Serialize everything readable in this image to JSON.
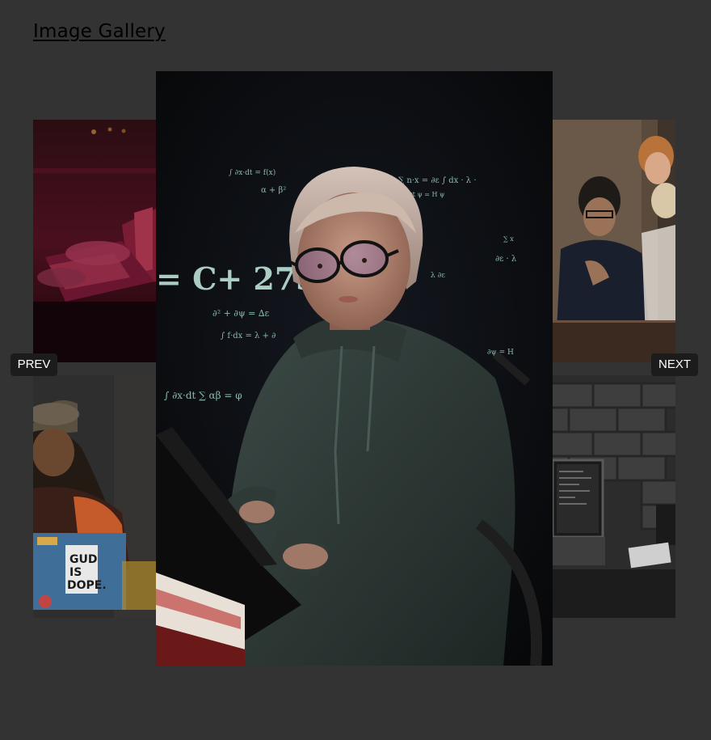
{
  "header": {
    "title": "Image Gallery"
  },
  "gallery": {
    "thumbnails": [
      {
        "position": "top-left",
        "subject": "hands on laptop in red neon light"
      },
      {
        "position": "bottom-left",
        "subject": "woman in cap with stickered laptop"
      },
      {
        "position": "top-right",
        "subject": "people at a meeting table"
      },
      {
        "position": "bottom-right",
        "subject": "laptop on desk by brick wall"
      }
    ],
    "main": {
      "subject": "girl in hoodie and glasses at laptop with projected math",
      "projected_text": "= C+ 273"
    }
  },
  "controls": {
    "prev_label": "PREV",
    "next_label": "NEXT"
  },
  "colors": {
    "background": "#333333",
    "button_bg": "#1c1c1c",
    "button_text": "#ffffff",
    "title_text": "#000000"
  }
}
